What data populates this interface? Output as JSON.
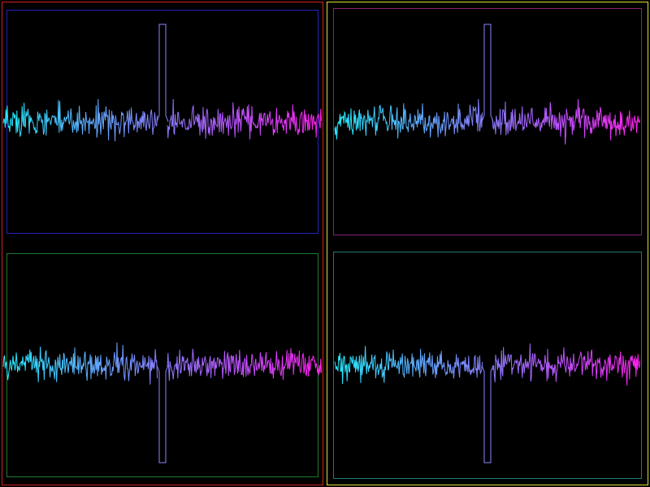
{
  "colors": {
    "background": "#000000",
    "left_column_frame": "#cc2222",
    "right_column_frame": "#dddd33",
    "spike_outline": "#8888ff",
    "trace_gradient": [
      "#22eeff",
      "#5ab0ff",
      "#8a7cff",
      "#c050ff",
      "#ff22ee"
    ]
  },
  "chart_data": [
    {
      "type": "line",
      "panel": "top-left",
      "frame_color": "#2222bb",
      "spike_direction": "up",
      "x_range": [
        0,
        1
      ],
      "spike_x": 0.5,
      "noise_amplitude": 0.08,
      "spike_amplitude": 1.0,
      "grid": false,
      "legend": "none"
    },
    {
      "type": "line",
      "panel": "top-right",
      "frame_color": "#882277",
      "spike_direction": "up",
      "x_range": [
        0,
        1
      ],
      "spike_x": 0.5,
      "noise_amplitude": 0.08,
      "spike_amplitude": 1.0,
      "grid": false,
      "legend": "none"
    },
    {
      "type": "line",
      "panel": "bottom-left",
      "frame_color": "#227733",
      "spike_direction": "down",
      "x_range": [
        0,
        1
      ],
      "spike_x": 0.5,
      "noise_amplitude": 0.08,
      "spike_amplitude": 1.0,
      "grid": false,
      "legend": "none"
    },
    {
      "type": "line",
      "panel": "bottom-right",
      "frame_color": "#227777",
      "spike_direction": "down",
      "x_range": [
        0,
        1
      ],
      "spike_x": 0.5,
      "noise_amplitude": 0.08,
      "spike_amplitude": 1.0,
      "grid": false,
      "legend": "none"
    }
  ]
}
